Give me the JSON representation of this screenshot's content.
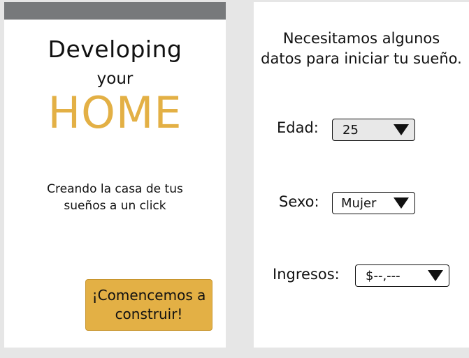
{
  "intro": {
    "title_line1": "Developing",
    "title_line2": "your",
    "title_line3": "HOME",
    "tagline": "Creando la casa de tus sueños a un click",
    "start_button": "¡Comencemos a construir!"
  },
  "form": {
    "heading": "Necesitamos algunos datos para iniciar tu sueño.",
    "age": {
      "label": "Edad:",
      "value": "25"
    },
    "sex": {
      "label": "Sexo:",
      "value": "Mujer"
    },
    "income": {
      "label": "Ingresos:",
      "value": "$--,---"
    }
  },
  "colors": {
    "accent": "#e3b045",
    "topbar": "#77797b",
    "background": "#e6e6e6"
  },
  "icons": {
    "dropdown": "triangle-down-icon"
  }
}
